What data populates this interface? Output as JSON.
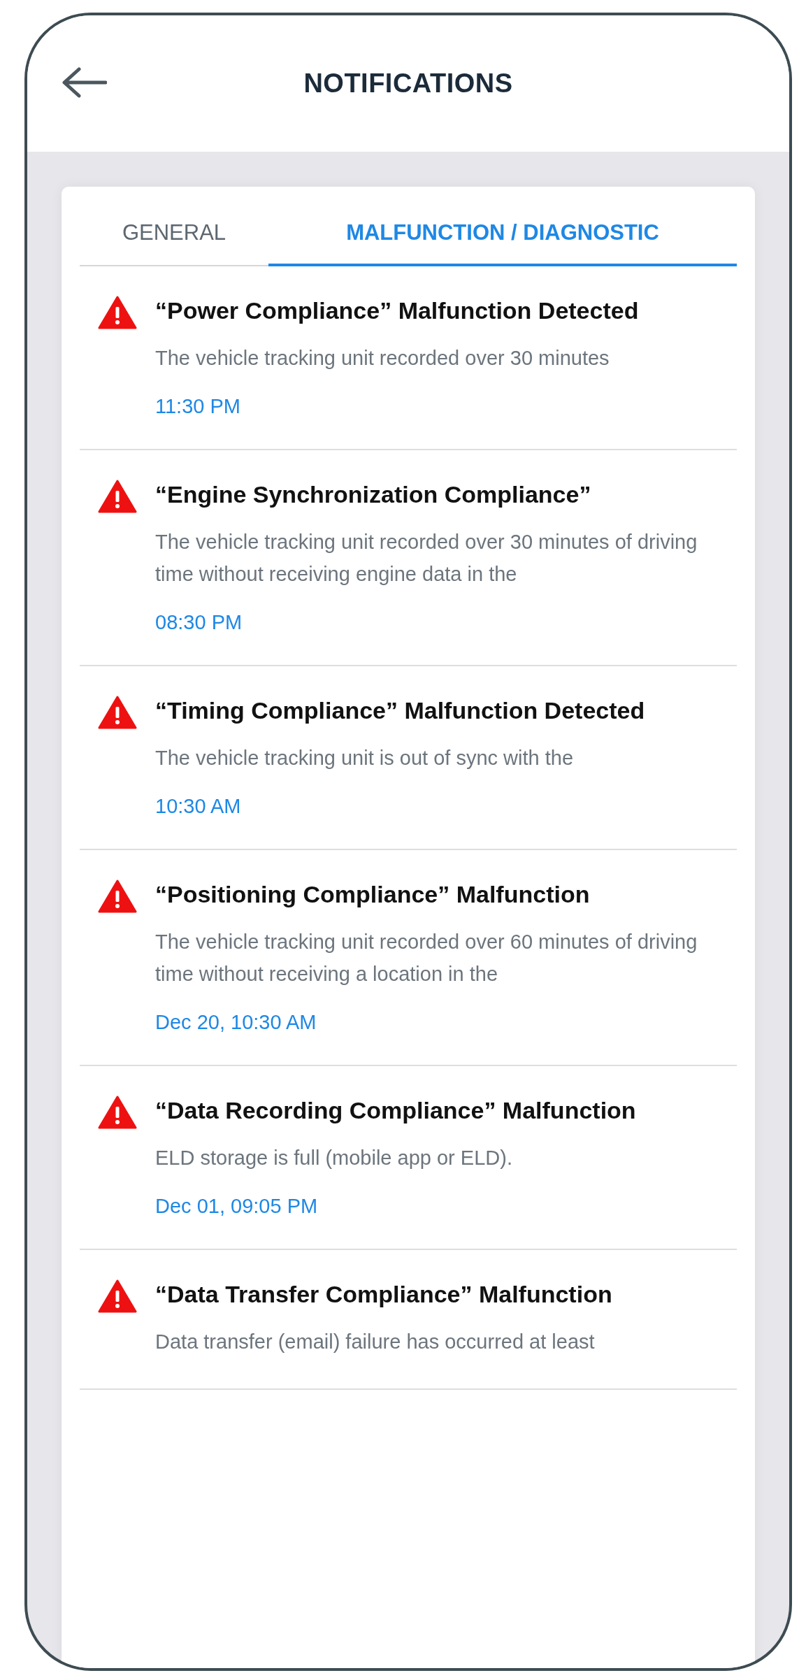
{
  "header": {
    "title": "NOTIFICATIONS"
  },
  "tabs": [
    {
      "label": "GENERAL",
      "selected": false
    },
    {
      "label": "MALFUNCTION / DIAGNOSTIC",
      "selected": true
    }
  ],
  "notifications": [
    {
      "title": "“Power Compliance” Malfunction Detected",
      "description": "The vehicle tracking unit recorded over 30 minutes",
      "time": "11:30 PM"
    },
    {
      "title": "“Engine Synchronization Compliance”",
      "description": "The vehicle tracking unit recorded over 30 minutes of driving time without receiving engine data in the",
      "time": "08:30 PM"
    },
    {
      "title": "“Timing Compliance” Malfunction Detected",
      "description": "The vehicle tracking unit is out of sync with the",
      "time": "10:30 AM"
    },
    {
      "title": "“Positioning Compliance” Malfunction",
      "description": "The vehicle tracking unit recorded over 60 minutes of driving time without receiving a location in the",
      "time": "Dec 20, 10:30 AM"
    },
    {
      "title": "“Data Recording Compliance” Malfunction",
      "description": "ELD storage is full (mobile app or ELD).",
      "time": "Dec 01, 09:05 PM"
    },
    {
      "title": "“Data Transfer Compliance” Malfunction",
      "description": "Data transfer (email) failure has occurred at least"
    }
  ]
}
